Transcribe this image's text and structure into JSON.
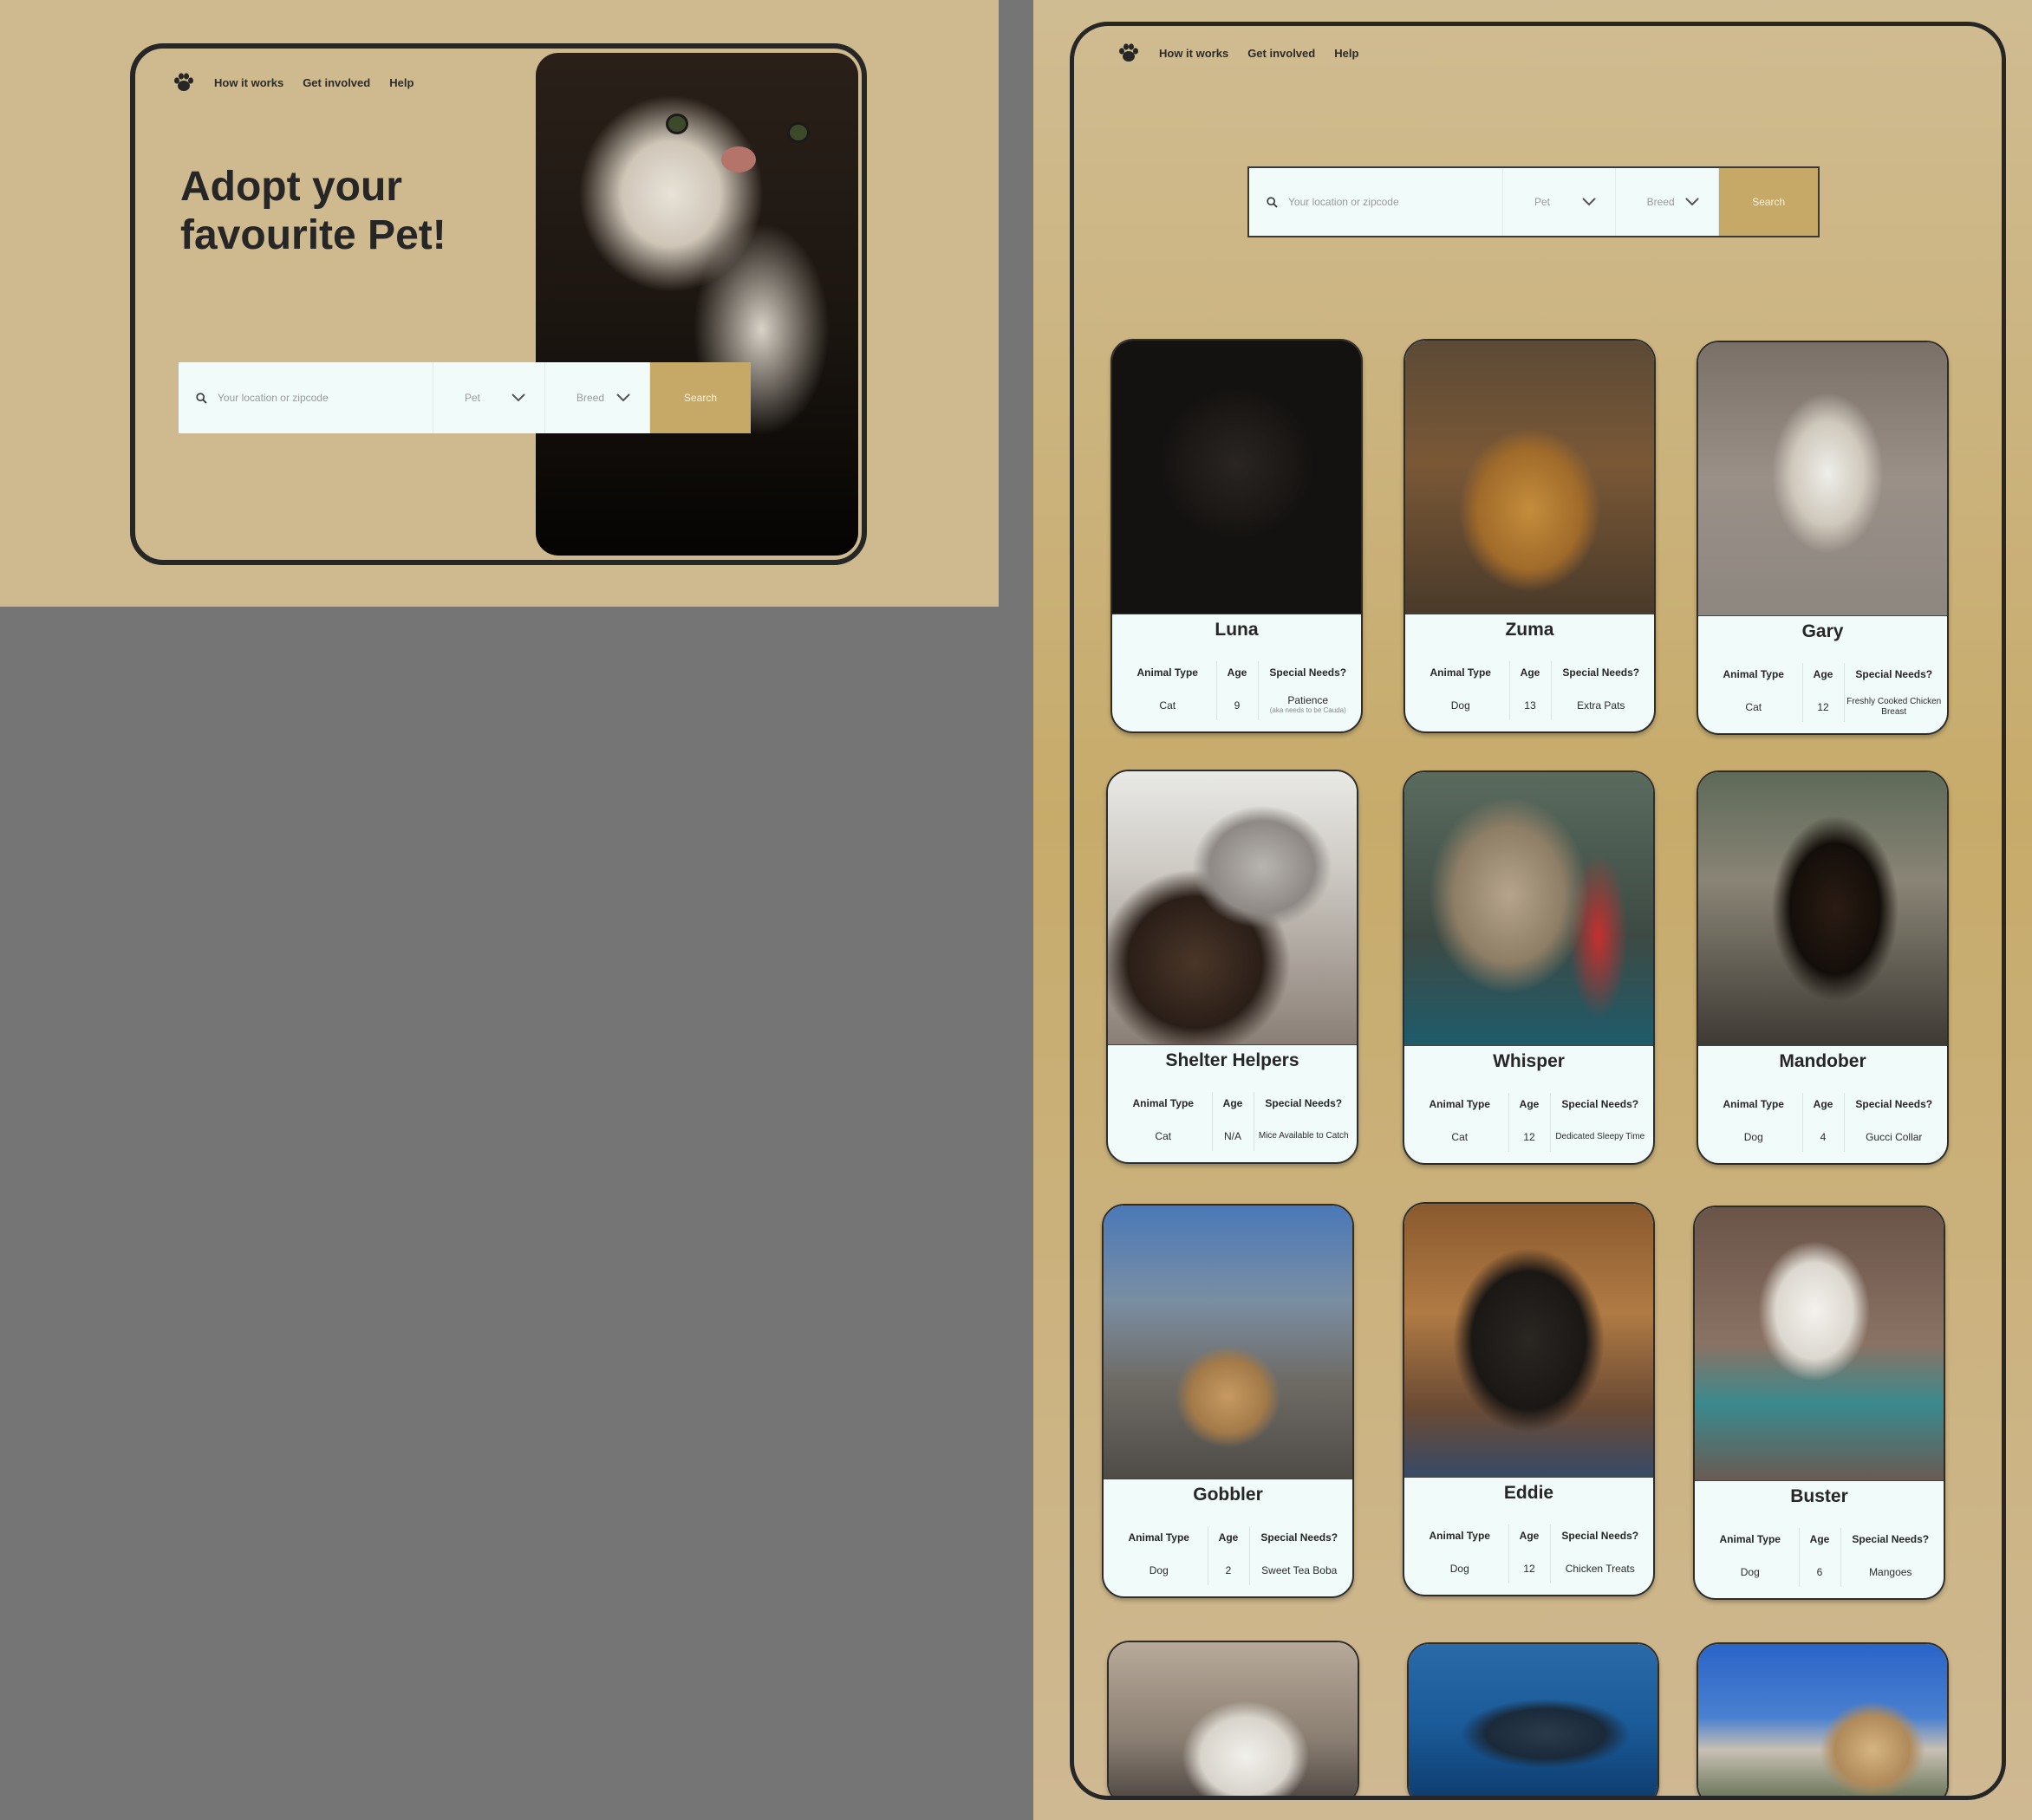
{
  "nav": {
    "links": [
      "How it works",
      "Get involved",
      "Help"
    ]
  },
  "hero": {
    "title": "Adopt your favourite Pet!"
  },
  "search": {
    "placeholder": "Your location or zipcode",
    "pet_label": "Pet",
    "breed_label": "Breed",
    "button_label": "Search"
  },
  "table_headers": {
    "animal_type": "Animal Type",
    "age": "Age",
    "special_needs": "Special Needs?"
  },
  "pets": [
    {
      "name": "Luna",
      "type": "Cat",
      "age": "9",
      "needs": "Patience",
      "needs_note": "(aka needs to be Cauda)"
    },
    {
      "name": "Zuma",
      "type": "Dog",
      "age": "13",
      "needs": "Extra Pats",
      "needs_note": ""
    },
    {
      "name": "Gary",
      "type": "Cat",
      "age": "12",
      "needs": "Freshly Cooked Chicken Breast",
      "needs_note": ""
    },
    {
      "name": "Shelter Helpers",
      "type": "Cat",
      "age": "N/A",
      "needs": "Mice Available to Catch",
      "needs_note": ""
    },
    {
      "name": "Whisper",
      "type": "Cat",
      "age": "12",
      "needs": "Dedicated Sleepy Time",
      "needs_note": ""
    },
    {
      "name": "Mandober",
      "type": "Dog",
      "age": "4",
      "needs": "Gucci Collar",
      "needs_note": ""
    },
    {
      "name": "Gobbler",
      "type": "Dog",
      "age": "2",
      "needs": "Sweet Tea Boba",
      "needs_note": ""
    },
    {
      "name": "Eddie",
      "type": "Dog",
      "age": "12",
      "needs": "Chicken Treats",
      "needs_note": ""
    },
    {
      "name": "Buster",
      "type": "Dog",
      "age": "6",
      "needs": "Mangoes",
      "needs_note": ""
    }
  ],
  "icons": {
    "logo": "paw-icon",
    "search": "search-icon",
    "dropdown": "chevron-down-icon"
  },
  "colors": {
    "background": "#cfba90",
    "accent": "#c6a867",
    "search_field": "#f1fbfa",
    "frame_border": "#262626",
    "canvas_gray": "#757575"
  }
}
